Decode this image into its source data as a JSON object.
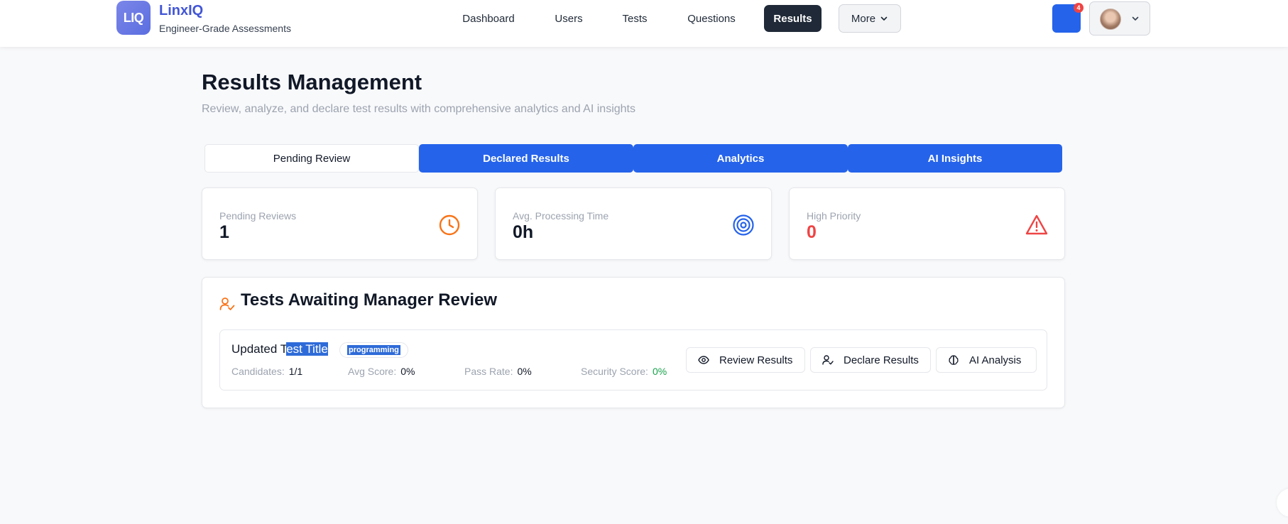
{
  "brand": {
    "logo": "LIQ",
    "name": "LinxIQ",
    "tagline": "Engineer-Grade Assessments"
  },
  "nav": {
    "items": [
      "Dashboard",
      "Users",
      "Tests",
      "Questions",
      "Results"
    ],
    "active": "Results",
    "more_label": "More"
  },
  "header": {
    "notification_count": "4"
  },
  "page": {
    "title": "Results Management",
    "subtitle": "Review, analyze, and declare test results with comprehensive analytics and AI insights"
  },
  "tabs": [
    "Pending Review",
    "Declared Results",
    "Analytics",
    "AI Insights"
  ],
  "stats": [
    {
      "label": "Pending Reviews",
      "value": "1",
      "icon": "clock-icon"
    },
    {
      "label": "Avg. Processing Time",
      "value": "0h",
      "icon": "target-icon"
    },
    {
      "label": "High Priority",
      "value": "0",
      "icon": "alert-triangle-icon"
    }
  ],
  "review": {
    "title": "Tests Awaiting Manager Review",
    "row": {
      "title_plain": "Updated T",
      "title_selected": "est Title",
      "tag": "programming",
      "candidates_label": "Candidates:",
      "candidates_value": "1/1",
      "avg_label": "Avg Score:",
      "avg_value": "0%",
      "pass_label": "Pass Rate:",
      "pass_value": "0%",
      "security_label": "Security Score:",
      "security_value": "0%"
    },
    "actions": [
      "Review Results",
      "Declare Results",
      "AI Analysis"
    ]
  },
  "colors": {
    "primary": "#2563eb",
    "brand": "#4256d6",
    "active_nav": "#1f2937",
    "warning": "#f97316",
    "danger": "#ef4444",
    "success": "#16a34a"
  }
}
